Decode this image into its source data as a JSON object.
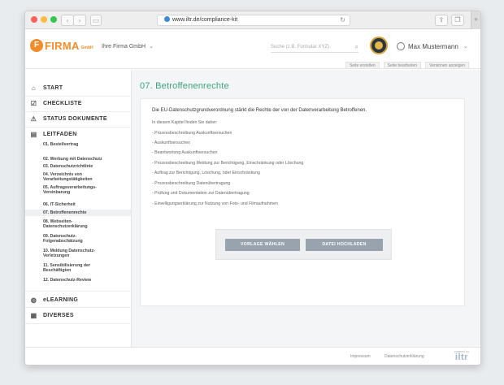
{
  "browser": {
    "url": "www.iltr.de/compliance-kit"
  },
  "header": {
    "logo_letter": "F",
    "logo_text": "FIRMA",
    "logo_sub": "GmbH",
    "company": "Ihre Firma GmbH",
    "search_placeholder": "Suche (z.B. Formular XYZ)",
    "user_name": "Max Mustermann"
  },
  "toolbar": [
    "Seite erstellen",
    "Seite bearbeiten",
    "Versionen anzeigen"
  ],
  "sidebar": {
    "start": "START",
    "checkliste": "CHECKLISTE",
    "status": "STATUS DOKUMENTE",
    "leitfaden": "LEITFADEN",
    "chapters": [
      "01. Bestellvertrag",
      "02. Werbung mit Datenschutz",
      "03. Datenschutzrichtlinie",
      "04. Verzeichnis von\nVerarbeitungstätigkeiten",
      "05. Auftragsverarbeitungs-\nVereinbarung",
      "06. IT-Sicherheit",
      "07. Betroffenenrechte",
      "08. Webseiten-\nDatenschutzerklärung",
      "09. Datenschutz-\nFolgenabschätzung",
      "10. Meldung Datenschutz-\nVerletzungen",
      "11. Sensibilisierung der\nBeschäftigten",
      "12. Datenschutz-Review"
    ],
    "elearning": "eLEARNING",
    "diverses": "DIVERSES"
  },
  "main": {
    "title": "07. Betroffenenrechte",
    "lead": "Die EU-Datenschutzgrundverordnung stärkt die Rechte der von der Datenverarbeitung Betroffenen.",
    "intro": "In diesem Kapitel finden Sie daher:",
    "bullets": [
      "- Prozessbeschreibung Auskunftsersuchen",
      "- Auskunftsersuchen",
      "- Beantwortung Auskunftsersuchen",
      "- Prozessbeschreibung Meldung zur Berichtigung, Einschränkung oder Löschung",
      "- Auftrag zur Berichtigung, Löschung, oder Einschränkung",
      "- Prozessbeschreibung Datenübertragung",
      "- Prüfung und Dokumentation zur Datenübertragung",
      "- Einwilligungserklärung zur Nutzung von Foto- und Filmaufnahmen"
    ],
    "btn_template": "VORLAGE WÄHLEN",
    "btn_upload": "DATEI HOCHLADEN"
  },
  "footer": {
    "impressum": "Impressum",
    "datenschutz": "Datenschutzerklärung",
    "powered": "powered by",
    "brand": "iltr"
  }
}
